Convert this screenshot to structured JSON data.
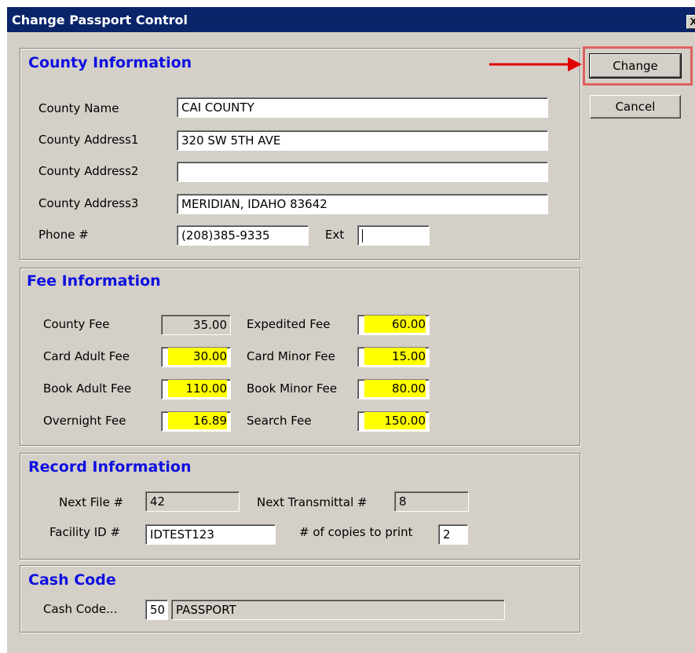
{
  "window": {
    "title": "Change Passport Control",
    "close_label": "X"
  },
  "buttons": {
    "change": "Change",
    "cancel": "Cancel"
  },
  "county": {
    "section_title": "County Information",
    "name_label": "County Name",
    "name_value": "CAI COUNTY",
    "addr1_label": "County Address1",
    "addr1_value": "320 SW 5TH AVE",
    "addr2_label": "County Address2",
    "addr2_value": "",
    "addr3_label": "County Address3",
    "addr3_value": "MERIDIAN, IDAHO 83642",
    "phone_label": "Phone #",
    "phone_value": "(208)385-9335",
    "ext_label": "Ext",
    "ext_value": ""
  },
  "fee": {
    "section_title": "Fee Information",
    "county_fee_label": "County Fee",
    "county_fee": "35.00",
    "expedited_fee_label": "Expedited Fee",
    "expedited_fee": "60.00",
    "card_adult_label": "Card Adult Fee",
    "card_adult": "30.00",
    "card_minor_label": "Card Minor Fee",
    "card_minor": "15.00",
    "book_adult_label": "Book Adult Fee",
    "book_adult": "110.00",
    "book_minor_label": "Book Minor Fee",
    "book_minor": "80.00",
    "overnight_label": "Overnight Fee",
    "overnight": "16.89",
    "search_label": "Search Fee",
    "search": "150.00"
  },
  "record": {
    "section_title": "Record Information",
    "next_file_label": "Next File #",
    "next_file": "42",
    "next_transmittal_label": "Next Transmittal #",
    "next_transmittal": "8",
    "facility_label": "Facility ID #",
    "facility": "IDTEST123",
    "copies_label": "# of copies to print",
    "copies": "2"
  },
  "cash": {
    "section_title": "Cash Code",
    "label": "Cash Code...",
    "code": "50",
    "description": "PASSPORT"
  },
  "colors": {
    "title_bar": "#0a246a",
    "section_title": "#1010e0",
    "highlight_fee": "#ffff00",
    "annotation": "#e00000"
  }
}
